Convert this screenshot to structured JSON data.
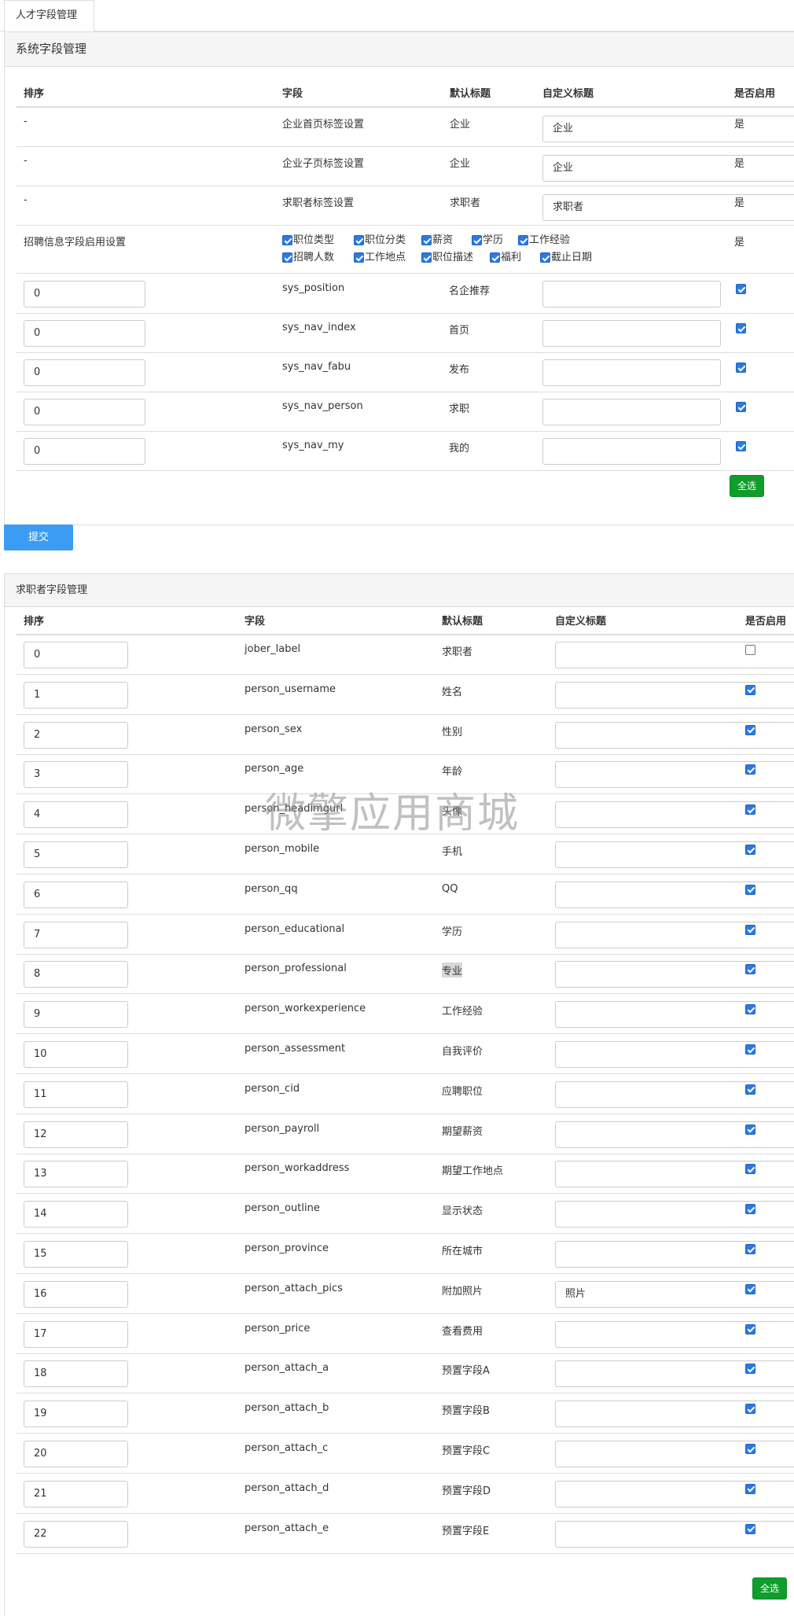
{
  "tab": {
    "label": "人才字段管理"
  },
  "system": {
    "title": "系统字段管理",
    "headers": {
      "order": "排序",
      "field": "字段",
      "default_title": "默认标题",
      "custom_title": "自定义标题",
      "enabled": "是否启用"
    },
    "label_rows": [
      {
        "order": "-",
        "field": "企业首页标签设置",
        "default_title": "企业",
        "custom_title": "企业",
        "enabled": "是"
      },
      {
        "order": "-",
        "field": "企业子页标签设置",
        "default_title": "企业",
        "custom_title": "企业",
        "enabled": "是"
      },
      {
        "order": "-",
        "field": "求职者标签设置",
        "default_title": "求职者",
        "custom_title": "求职者",
        "enabled": "是"
      }
    ],
    "recruit_row": {
      "order": "招聘信息字段启用设置",
      "enabled": "是",
      "options": [
        {
          "label": "职位类型",
          "checked": true
        },
        {
          "label": "职位分类",
          "checked": true
        },
        {
          "label": "薪资",
          "checked": true
        },
        {
          "label": "学历",
          "checked": true
        },
        {
          "label": "工作经验",
          "checked": true
        },
        {
          "label": "招聘人数",
          "checked": true
        },
        {
          "label": "工作地点",
          "checked": true
        },
        {
          "label": "职位描述",
          "checked": true
        },
        {
          "label": "福利",
          "checked": true
        },
        {
          "label": "截止日期",
          "checked": true
        }
      ]
    },
    "rows": [
      {
        "order": "0",
        "field": "sys_position",
        "default_title": "名企推荐",
        "custom_title": "",
        "checked": true
      },
      {
        "order": "0",
        "field": "sys_nav_index",
        "default_title": "首页",
        "custom_title": "",
        "checked": true
      },
      {
        "order": "0",
        "field": "sys_nav_fabu",
        "default_title": "发布",
        "custom_title": "",
        "checked": true
      },
      {
        "order": "0",
        "field": "sys_nav_person",
        "default_title": "求职",
        "custom_title": "",
        "checked": true
      },
      {
        "order": "0",
        "field": "sys_nav_my",
        "default_title": "我的",
        "custom_title": "",
        "checked": true
      }
    ],
    "select_all_label": "全选"
  },
  "submit_label": "提交",
  "jobseeker": {
    "title": "求职者字段管理",
    "headers": {
      "order": "排序",
      "field": "字段",
      "default_title": "默认标题",
      "custom_title": "自定义标题",
      "enabled": "是否启用"
    },
    "rows": [
      {
        "order": "0",
        "field": "jober_label",
        "default_title": "求职者",
        "custom_title": "",
        "checked": false
      },
      {
        "order": "1",
        "field": "person_username",
        "default_title": "姓名",
        "custom_title": "",
        "checked": true
      },
      {
        "order": "2",
        "field": "person_sex",
        "default_title": "性别",
        "custom_title": "",
        "checked": true
      },
      {
        "order": "3",
        "field": "person_age",
        "default_title": "年龄",
        "custom_title": "",
        "checked": true
      },
      {
        "order": "4",
        "field": "person_headimgurl",
        "default_title": "头像",
        "custom_title": "",
        "checked": true
      },
      {
        "order": "5",
        "field": "person_mobile",
        "default_title": "手机",
        "custom_title": "",
        "checked": true
      },
      {
        "order": "6",
        "field": "person_qq",
        "default_title": "QQ",
        "custom_title": "",
        "checked": true
      },
      {
        "order": "7",
        "field": "person_educational",
        "default_title": "学历",
        "custom_title": "",
        "checked": true
      },
      {
        "order": "8",
        "field": "person_professional",
        "default_title": "专业",
        "custom_title": "",
        "checked": true
      },
      {
        "order": "9",
        "field": "person_workexperience",
        "default_title": "工作经验",
        "custom_title": "",
        "checked": true
      },
      {
        "order": "10",
        "field": "person_assessment",
        "default_title": "自我评价",
        "custom_title": "",
        "checked": true
      },
      {
        "order": "11",
        "field": "person_cid",
        "default_title": "应聘职位",
        "custom_title": "",
        "checked": true
      },
      {
        "order": "12",
        "field": "person_payroll",
        "default_title": "期望薪资",
        "custom_title": "",
        "checked": true
      },
      {
        "order": "13",
        "field": "person_workaddress",
        "default_title": "期望工作地点",
        "custom_title": "",
        "checked": true
      },
      {
        "order": "14",
        "field": "person_outline",
        "default_title": "显示状态",
        "custom_title": "",
        "checked": true
      },
      {
        "order": "15",
        "field": "person_province",
        "default_title": "所在城市",
        "custom_title": "",
        "checked": true
      },
      {
        "order": "16",
        "field": "person_attach_pics",
        "default_title": "附加照片",
        "custom_title": "照片",
        "checked": true
      },
      {
        "order": "17",
        "field": "person_price",
        "default_title": "查看费用",
        "custom_title": "",
        "checked": true
      },
      {
        "order": "18",
        "field": "person_attach_a",
        "default_title": "预置字段A",
        "custom_title": "",
        "checked": true
      },
      {
        "order": "19",
        "field": "person_attach_b",
        "default_title": "预置字段B",
        "custom_title": "",
        "checked": true
      },
      {
        "order": "20",
        "field": "person_attach_c",
        "default_title": "预置字段C",
        "custom_title": "",
        "checked": true
      },
      {
        "order": "21",
        "field": "person_attach_d",
        "default_title": "预置字段D",
        "custom_title": "",
        "checked": true
      },
      {
        "order": "22",
        "field": "person_attach_e",
        "default_title": "预置字段E",
        "custom_title": "",
        "checked": true
      }
    ],
    "select_all_label": "全选"
  },
  "watermark": "微擎应用商城",
  "colors": {
    "accent_blue": "#3a9cf2",
    "accent_green": "#0f9d2c",
    "checkbox_blue": "#2a7ae2"
  }
}
